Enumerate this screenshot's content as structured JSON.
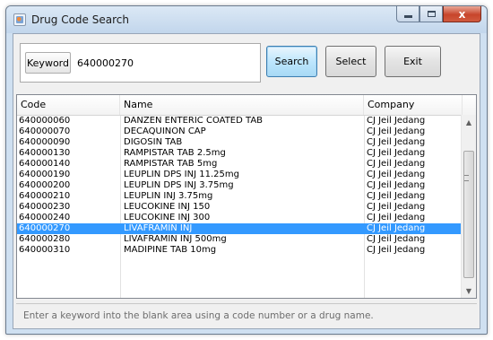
{
  "window": {
    "title": "Drug Code Search",
    "controls": {
      "minimize": "minimize",
      "maximize": "maximize",
      "close": "x"
    }
  },
  "search": {
    "keyword_label": "Keyword",
    "keyword_value": "640000270",
    "search_label": "Search",
    "select_label": "Select",
    "exit_label": "Exit"
  },
  "table": {
    "columns": {
      "code": "Code",
      "name": "Name",
      "company": "Company"
    },
    "rows": [
      {
        "code": "640000060",
        "name": "DANZEN ENTERIC COATED TAB",
        "company": "CJ Jeil Jedang"
      },
      {
        "code": "640000070",
        "name": "DECAQUINON CAP",
        "company": "CJ Jeil Jedang"
      },
      {
        "code": "640000090",
        "name": "DIGOSIN TAB",
        "company": "CJ Jeil Jedang"
      },
      {
        "code": "640000130",
        "name": "RAMPISTAR TAB 2.5mg",
        "company": "CJ Jeil Jedang"
      },
      {
        "code": "640000140",
        "name": "RAMPISTAR TAB 5mg",
        "company": "CJ Jeil Jedang"
      },
      {
        "code": "640000190",
        "name": "LEUPLIN DPS INJ 11.25mg",
        "company": "CJ Jeil Jedang"
      },
      {
        "code": "640000200",
        "name": "LEUPLIN DPS INJ  3.75mg",
        "company": "CJ Jeil Jedang"
      },
      {
        "code": "640000210",
        "name": "LEUPLIN INJ 3.75mg",
        "company": "CJ Jeil Jedang"
      },
      {
        "code": "640000230",
        "name": "LEUCOKINE INJ 150",
        "company": "CJ Jeil Jedang"
      },
      {
        "code": "640000240",
        "name": "LEUCOKINE INJ 300",
        "company": "CJ Jeil Jedang"
      },
      {
        "code": "640000270",
        "name": "LIVAFRAMIN INJ",
        "company": "CJ Jeil Jedang",
        "selected": true
      },
      {
        "code": "640000280",
        "name": "LIVAFRAMIN INJ 500mg",
        "company": "CJ Jeil Jedang"
      },
      {
        "code": "640000310",
        "name": "MADIPINE TAB 10mg",
        "company": "CJ Jeil Jedang"
      }
    ],
    "selected_row_color": "#3399ff"
  },
  "icons": {
    "app": "pill-app-icon",
    "scroll_up": "chevron-up-icon",
    "scroll_down": "chevron-down-icon"
  },
  "status": {
    "hint": "Enter a keyword into the blank area using a code number or a drug name."
  }
}
